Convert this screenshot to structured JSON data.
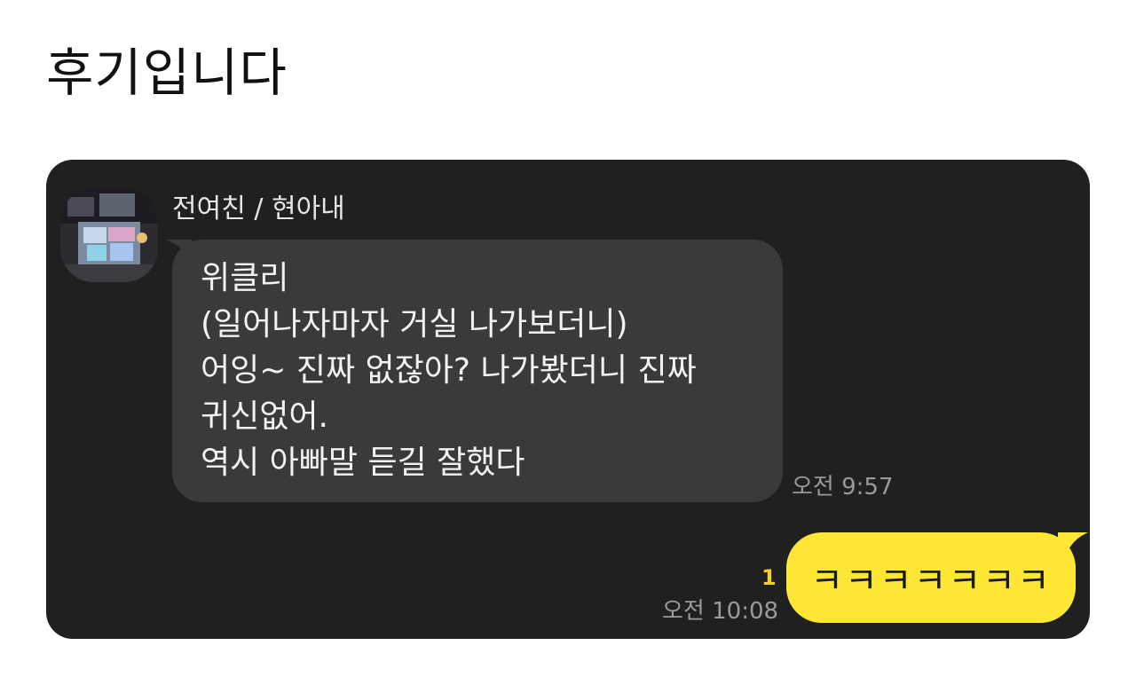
{
  "post": {
    "title": "후기입니다"
  },
  "chat": {
    "sender": {
      "name": "전여친 / 현아내",
      "avatar_icon": "profile-photo"
    },
    "received_message": {
      "lines": [
        "위클리",
        "(일어나자마자 거실 나가보더니)",
        "어잉~ 진짜 없잖아? 나가봤더니 진짜",
        "귀신없어.",
        "역시 아빠말 듣길 잘했다"
      ],
      "time": "오전 9:57"
    },
    "sent_message": {
      "text": "ㅋㅋㅋㅋㅋㅋㅋ",
      "unread_count": "1",
      "time": "오전 10:08"
    }
  },
  "colors": {
    "chat_background": "#202020",
    "received_bubble": "#3a3a3a",
    "sent_bubble": "#fde734",
    "unread_count": "#f5d02a"
  }
}
